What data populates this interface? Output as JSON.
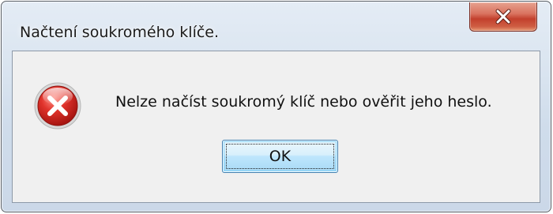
{
  "window": {
    "title": "Načtení soukromého klíče.",
    "close_icon": "close-icon"
  },
  "dialog": {
    "icon": "error-icon",
    "message": "Nelze načíst soukromý klíč nebo ověřit jeho heslo.",
    "ok_label": "OK"
  },
  "colors": {
    "close_button": "#c7442f",
    "error_icon": "#c9251f",
    "ok_border": "#3c7fb1"
  }
}
